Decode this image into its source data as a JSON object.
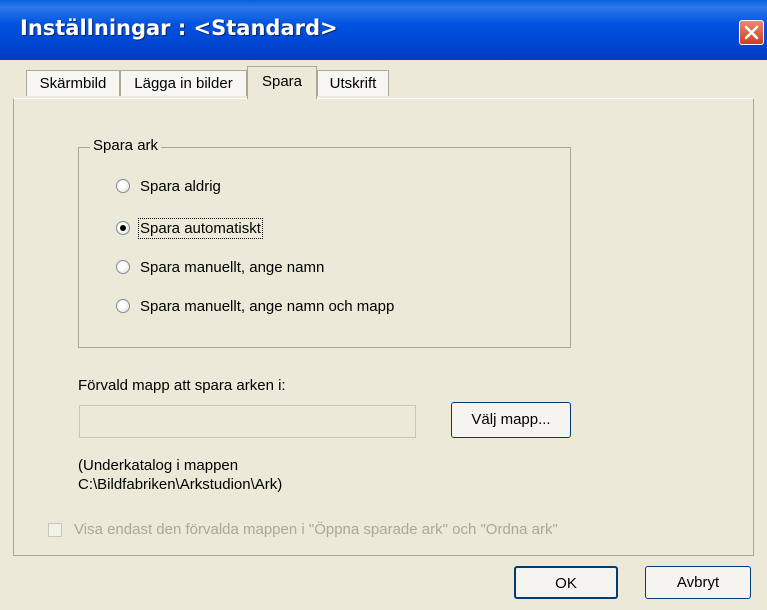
{
  "window": {
    "title": "Inställningar : <Standard>"
  },
  "tabs": [
    {
      "label": "Skärmbild"
    },
    {
      "label": "Lägga in bilder"
    },
    {
      "label": "Spara"
    },
    {
      "label": "Utskrift"
    }
  ],
  "group": {
    "label": "Spara ark",
    "options": [
      {
        "label": "Spara aldrig",
        "checked": false
      },
      {
        "label": "Spara automatiskt",
        "checked": true
      },
      {
        "label": "Spara manuellt, ange namn",
        "checked": false
      },
      {
        "label": "Spara manuellt, ange namn och mapp",
        "checked": false
      }
    ]
  },
  "folder": {
    "label": "Förvald mapp att spara arken i:",
    "value": "",
    "choose_button": "Välj mapp...",
    "note_line1": "(Underkatalog i mappen",
    "note_line2": "C:\\Bildfabriken\\Arkstudion\\Ark)"
  },
  "checkbox": {
    "label": "Visa endast den förvalda mappen i \"Öppna sparade ark\" och \"Ordna ark\"",
    "checked": false
  },
  "buttons": {
    "ok": "OK",
    "cancel": "Avbryt"
  },
  "colors": {
    "title_bar": "#0053e0",
    "dialog_bg": "#ece9d8",
    "disabled_text": "#aca899"
  }
}
